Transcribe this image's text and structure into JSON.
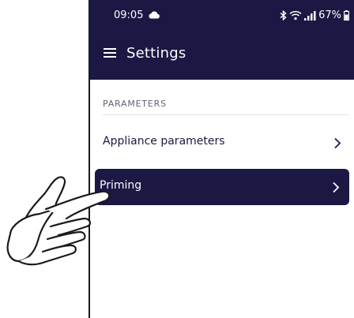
{
  "status_bar": {
    "time": "09:05",
    "battery": "67%"
  },
  "app_bar": {
    "title": "Settings"
  },
  "section": {
    "header": "PARAMETERS"
  },
  "rows": [
    {
      "label": "Appliance parameters"
    },
    {
      "label": "Priming"
    }
  ],
  "colors": {
    "primary": "#1b1844",
    "text_on_primary": "#ffffff"
  },
  "icons": {
    "cloud": "cloud-icon",
    "bluetooth": "bluetooth-icon",
    "wifi": "wifi-icon",
    "signal": "signal-icon",
    "battery": "battery-icon",
    "menu": "menu-icon",
    "chevron": "chevron-right-icon",
    "hand": "pointing-hand-icon"
  }
}
